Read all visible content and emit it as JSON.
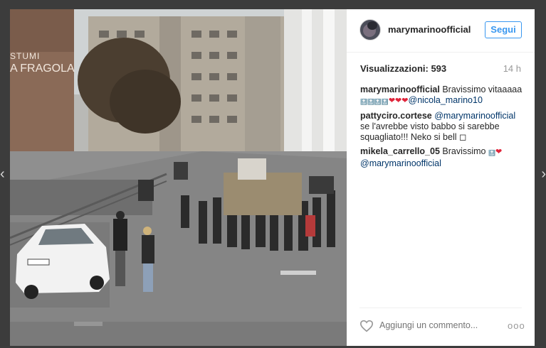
{
  "post": {
    "username": "marymarinoofficial",
    "follow_label": "Segui",
    "views_label": "Visualizzazioni: 593",
    "time": "14 h",
    "photo_sign": {
      "line1": "STUMI",
      "line2": "A FRAGOLA"
    }
  },
  "comments": [
    {
      "user": "marymarinoofficial",
      "text_before": "Bravissimo vitaaaaa ",
      "emoji_top": "🔝🔝🔝🔝",
      "emoji_hearts": "❤❤❤",
      "mention": "@nicola_marino10",
      "text_after": ""
    },
    {
      "user": "pattyciro.cortese",
      "text_before": "",
      "emoji_top": "",
      "emoji_hearts": "",
      "mention": "@marymarinoofficial",
      "text_after": " se l'avrebbe visto babbo si sarebbe squagliato!!! Neko si bell ◻"
    },
    {
      "user": "mikela_carrello_05",
      "text_before": "Bravissimo ",
      "emoji_top": "🔝",
      "emoji_hearts": "❤",
      "mention": "@marymarinoofficial",
      "text_after": ""
    }
  ],
  "footer": {
    "comment_placeholder": "Aggiungi un commento...",
    "more_label": "ooo"
  },
  "nav": {
    "prev_icon": "‹",
    "next_icon": "›"
  }
}
